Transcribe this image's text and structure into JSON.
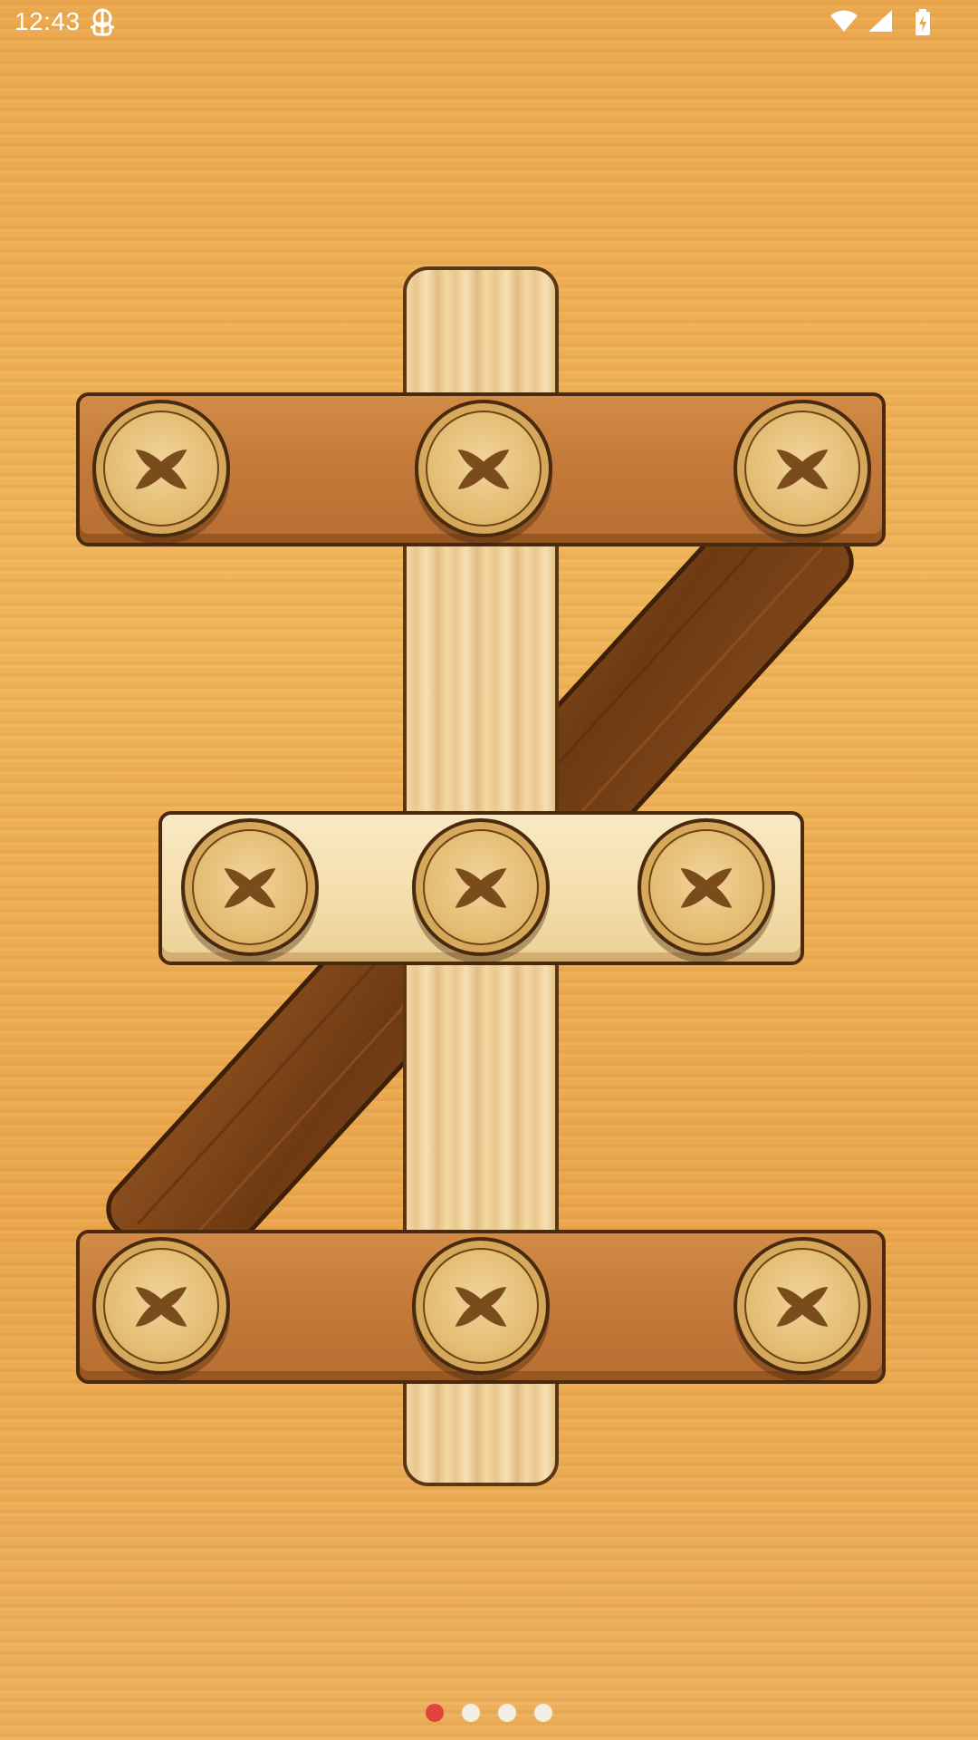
{
  "status_bar": {
    "time": "12:43",
    "icons": [
      "debug-icon",
      "wifi-icon",
      "cellular-signal-icon",
      "battery-charging-icon"
    ]
  },
  "colors": {
    "board": "#eba64c",
    "light_wood": "#f5dfae",
    "medium_wood": "#c47a3a",
    "dark_wood": "#7a4418",
    "screw_face": "#e4bd73",
    "screw_slot": "#7a4c1c",
    "dot_active": "#e0443c",
    "dot_inactive": "#f3eee4"
  },
  "pager": {
    "page_count": 4,
    "active_page": 1
  }
}
